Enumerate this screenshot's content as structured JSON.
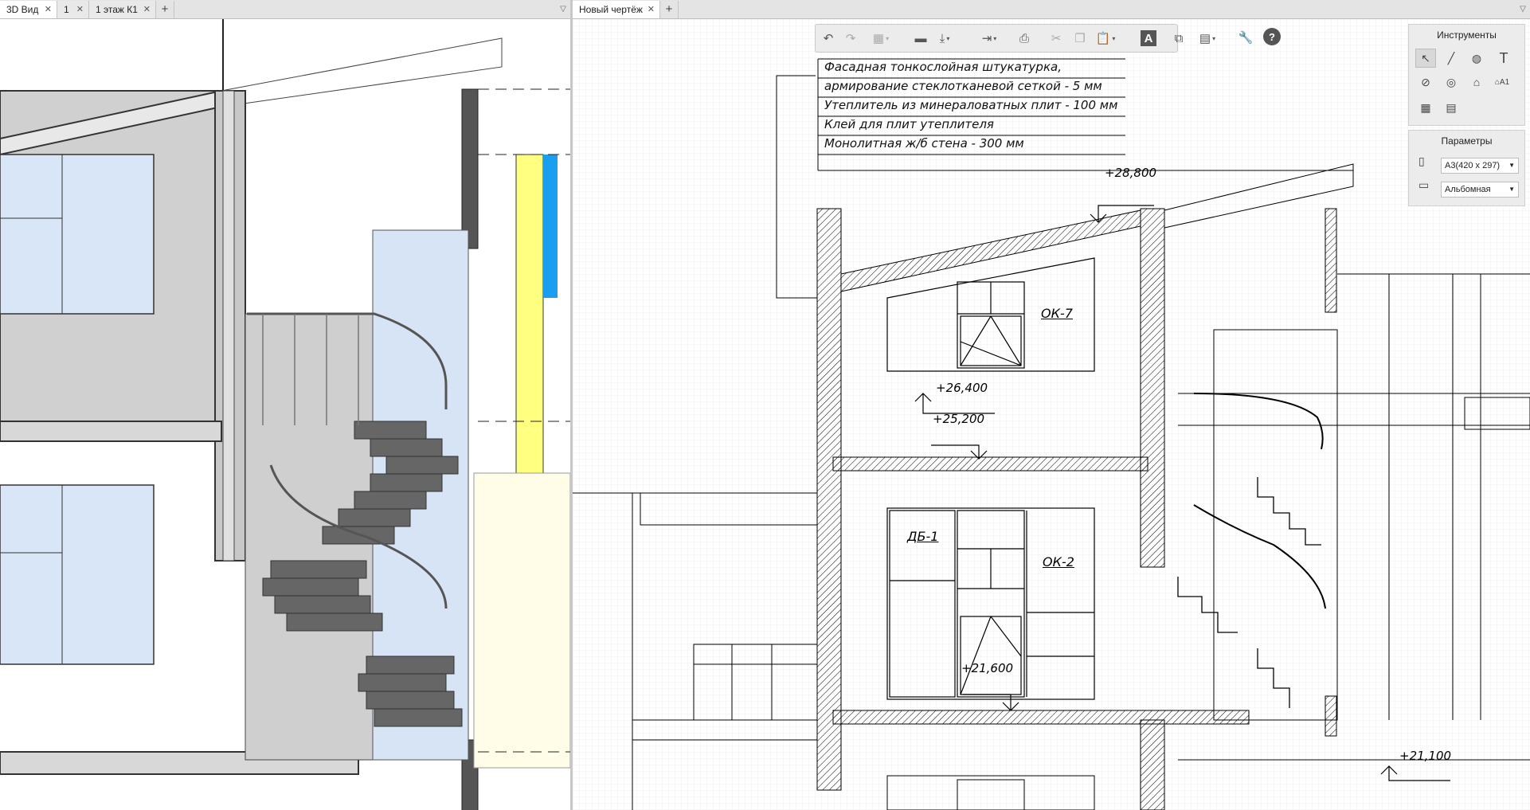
{
  "left_tabs": [
    {
      "label": "3D Вид"
    },
    {
      "label": "1"
    },
    {
      "label": "1 этаж К1"
    }
  ],
  "right_tabs": [
    {
      "label": "Новый чертёж"
    }
  ],
  "toolbar": {
    "buttons": [
      "undo-icon",
      "redo-icon",
      "view-3d-icon",
      "folder-open-icon",
      "save-icon",
      "export-icon",
      "print-icon",
      "cut-icon",
      "copy-icon",
      "paste-icon",
      "text-style-icon",
      "layers-icon",
      "table-icon",
      "settings-wrench-icon",
      "help-icon"
    ]
  },
  "tools_panel": {
    "title": "Инструменты",
    "tools": [
      "pointer-tool-icon",
      "line-tool-icon",
      "hatch-tool-icon",
      "text-tool-icon",
      "dimension-tool-icon",
      "leader-tool-icon",
      "level-mark-tool-icon",
      "stamp-tool-icon",
      "table-edit-tool-icon",
      "table-tool-icon"
    ]
  },
  "params_panel": {
    "title": "Параметры",
    "sheet_format": "А3(420 x 297)",
    "orientation": "Альбомная"
  },
  "drawing": {
    "leader_lines": [
      "Фасадная тонкослойная штукатурка,",
      "армирование стеклотканевой сеткой - 5 мм",
      "Утеплитель из минераловатных плит - 100 мм",
      "Клей для плит утеплителя",
      "Монолитная ж/б стена - 300 мм"
    ],
    "levels": {
      "l1": "+28,800",
      "l2": "+26,400",
      "l3": "+25,200",
      "l4": "+21,600",
      "l5": "+21,100"
    },
    "marks": {
      "ok7": "ОК-7",
      "ok2": "ОК-2",
      "db1": "ДБ-1"
    }
  }
}
